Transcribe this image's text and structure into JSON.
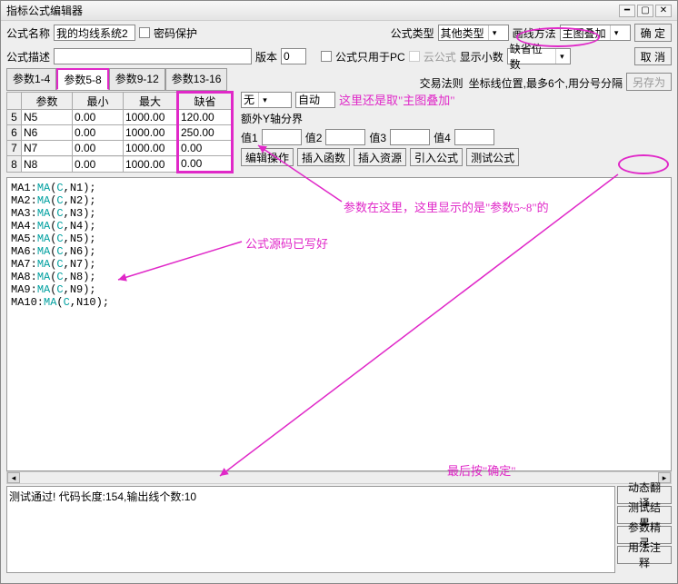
{
  "window": {
    "title": "指标公式编辑器"
  },
  "row1": {
    "name_label": "公式名称",
    "name_value": "我的均线系统2",
    "pwd_label": "密码保护",
    "type_label": "公式类型",
    "type_value": "其他类型",
    "draw_label": "画线方法",
    "draw_value": "主图叠加",
    "ok": "确  定"
  },
  "row2": {
    "desc_label": "公式描述",
    "desc_value": "",
    "ver_label": "版本",
    "ver_value": "0",
    "pc_label": "公式只用于PC",
    "cloud_label": "云公式",
    "dec_label": "显示小数",
    "dec_value": "缺省位数",
    "cancel": "取  消"
  },
  "tabs": [
    "参数1-4",
    "参数5-8",
    "参数9-12",
    "参数13-16"
  ],
  "ptable": {
    "headers": [
      "参数",
      "最小",
      "最大",
      "缺省"
    ],
    "rows": [
      {
        "idx": "5",
        "name": "N5",
        "min": "0.00",
        "max": "1000.00",
        "def": "120.00"
      },
      {
        "idx": "6",
        "name": "N6",
        "min": "0.00",
        "max": "1000.00",
        "def": "250.00"
      },
      {
        "idx": "7",
        "name": "N7",
        "min": "0.00",
        "max": "1000.00",
        "def": "0.00"
      },
      {
        "idx": "8",
        "name": "N8",
        "min": "0.00",
        "max": "1000.00",
        "def": "0.00"
      }
    ]
  },
  "right": {
    "rule_label": "交易法则",
    "coord_label": "坐标线位置,最多6个,用分号分隔",
    "saveas": "另存为",
    "rule_value": "无",
    "auto": "自动",
    "note1": "这里还是取\"主图叠加\"",
    "extra_label": "额外Y轴分界",
    "v1": "值1",
    "v2": "值2",
    "v3": "值3",
    "v4": "值4",
    "actions": [
      "编辑操作",
      "插入函数",
      "插入资源",
      "引入公式",
      "测试公式"
    ]
  },
  "code_lines": [
    {
      "n": "MA1",
      "f": "MA",
      "a": "C,N1"
    },
    {
      "n": "MA2",
      "f": "MA",
      "a": "C,N2"
    },
    {
      "n": "MA3",
      "f": "MA",
      "a": "C,N3"
    },
    {
      "n": "MA4",
      "f": "MA",
      "a": "C,N4"
    },
    {
      "n": "MA5",
      "f": "MA",
      "a": "C,N5"
    },
    {
      "n": "MA6",
      "f": "MA",
      "a": "C,N6"
    },
    {
      "n": "MA7",
      "f": "MA",
      "a": "C,N7"
    },
    {
      "n": "MA8",
      "f": "MA",
      "a": "C,N8"
    },
    {
      "n": "MA9",
      "f": "MA",
      "a": "C,N9"
    },
    {
      "n": "MA10",
      "f": "MA",
      "a": "C,N10"
    }
  ],
  "status": "测试通过! 代码长度:154,输出线个数:10",
  "sidebtns": [
    "动态翻译",
    "测试结果",
    "参数精灵",
    "用法注释"
  ],
  "annots": {
    "a1": "参数在这里，这里显示的是\"参数5~8\"的",
    "a2": "公式源码已写好",
    "a3": "最后按\"确定\""
  }
}
